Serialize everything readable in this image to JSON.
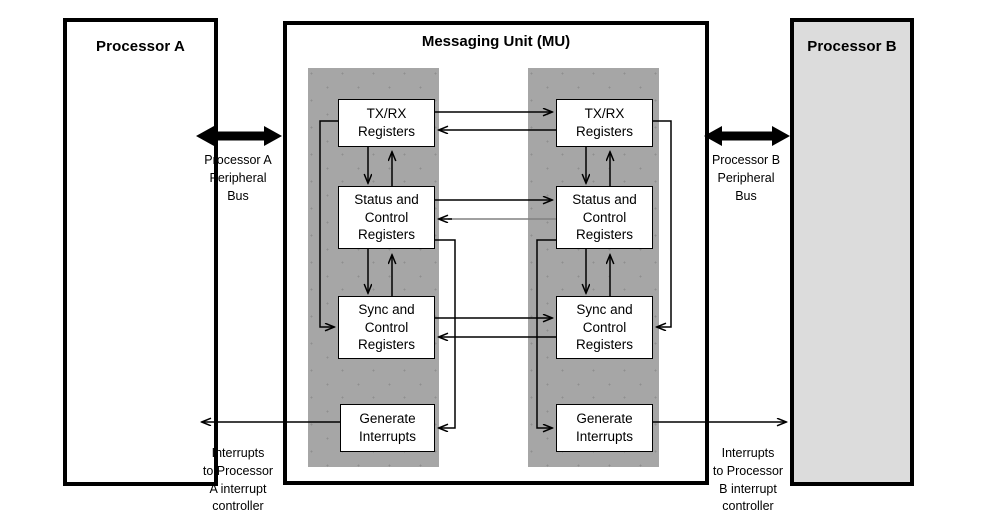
{
  "diagram": {
    "title": "Messaging Unit (MU)"
  },
  "processors": {
    "a": {
      "title": "Processor A"
    },
    "b": {
      "title": "Processor B"
    }
  },
  "mu": {
    "title": "Messaging Unit (MU)",
    "left_side": {
      "txrx": {
        "line1": "TX/RX",
        "line2": "Registers",
        "line3": ""
      },
      "status": {
        "line1": "Status and",
        "line2": "Control",
        "line3": "Registers"
      },
      "sync": {
        "line1": "Sync and",
        "line2": "Control",
        "line3": "Registers"
      },
      "gen": {
        "line1": "Generate",
        "line2": "Interrupts",
        "line3": ""
      }
    },
    "right_side": {
      "txrx": {
        "line1": "TX/RX",
        "line2": "Registers",
        "line3": ""
      },
      "status": {
        "line1": "Status and",
        "line2": "Control",
        "line3": "Registers"
      },
      "sync": {
        "line1": "Sync and",
        "line2": "Control",
        "line3": "Registers"
      },
      "gen": {
        "line1": "Generate",
        "line2": "Interrupts",
        "line3": ""
      }
    }
  },
  "buses": {
    "a": {
      "line1": "Processor A",
      "line2": "Peripheral",
      "line3": "Bus"
    },
    "b": {
      "line1": "Processor B",
      "line2": "Peripheral",
      "line3": "Bus"
    }
  },
  "interrupts": {
    "a": {
      "line1": "Interrupts",
      "line2": "to Processor",
      "line3": "A interrupt",
      "line4": "controller"
    },
    "b": {
      "line1": "Interrupts",
      "line2": "to Processor",
      "line3": "B interrupt",
      "line4": "controller"
    }
  },
  "colors": {
    "panel_gray": "#a6a6a6",
    "processor_b_fill": "#dcdcdc",
    "line_black": "#000000",
    "faded_line": "#808080"
  }
}
